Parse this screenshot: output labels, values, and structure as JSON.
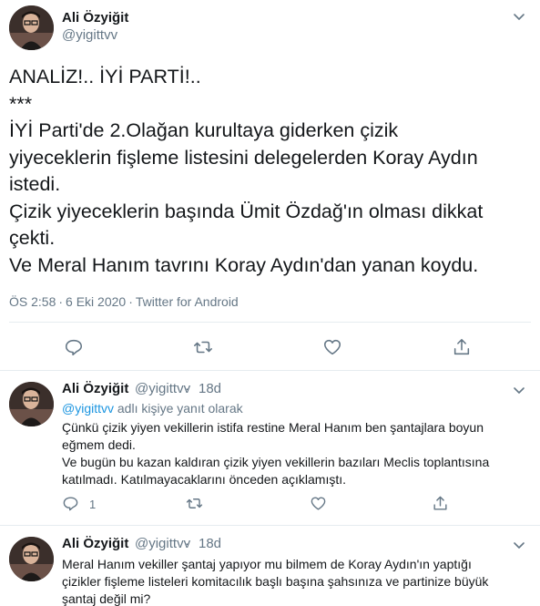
{
  "main_tweet": {
    "author_name": "Ali Özyiğit",
    "author_handle": "@yigittvv",
    "lines": [
      "ANALİZ!.. İYİ PARTİ!..",
      "***",
      "İYİ Parti'de 2.Olağan kurultaya giderken çizik",
      "yiyeceklerin fişleme listesini delegelerden Koray Aydın",
      "istedi.",
      "Çizik yiyeceklerin başında Ümit Özdağ'ın olması dikkat",
      "çekti.",
      "Ve Meral Hanım tavrını Koray Aydın'dan yanan koydu."
    ],
    "time": "ÖS 2:58",
    "date": "6 Eki 2020",
    "source": "Twitter for Android",
    "separator": "·"
  },
  "icons": [
    "reply-icon",
    "retweet-icon",
    "like-icon",
    "share-icon",
    "chevron-down-icon"
  ],
  "replies": [
    {
      "author_name": "Ali Özyiğit",
      "author_handle": "@yigittvv",
      "dot": "·",
      "time": "18d",
      "replying_mention": "@yigittvv",
      "replying_text": " adlı kişiye yanıt olarak",
      "lines": [
        "Çünkü çizik yiyen vekillerin istifa restine Meral Hanım ben şantajlara boyun",
        "eğmem dedi.",
        "Ve bugün bu kazan kaldıran çizik yiyen vekillerin bazıları Meclis toplantısına",
        "katılmadı. Katılmayacaklarını önceden açıklamıştı."
      ],
      "reply_count": "1"
    },
    {
      "author_name": "Ali Özyiğit",
      "author_handle": "@yigittvv",
      "dot": "·",
      "time": "18d",
      "lines": [
        "Meral Hanım vekiller şantaj yapıyor mu bilmem de Koray Aydın'ın yaptığı",
        "çizikler fişleme listeleri komitacılık başlı başına şahsınıza ve partinize büyük",
        "şantaj değil mi?"
      ]
    }
  ],
  "colors": {
    "text": "#14171a",
    "secondary": "#657786",
    "link": "#1b95e0",
    "border": "#e6ecf0"
  }
}
